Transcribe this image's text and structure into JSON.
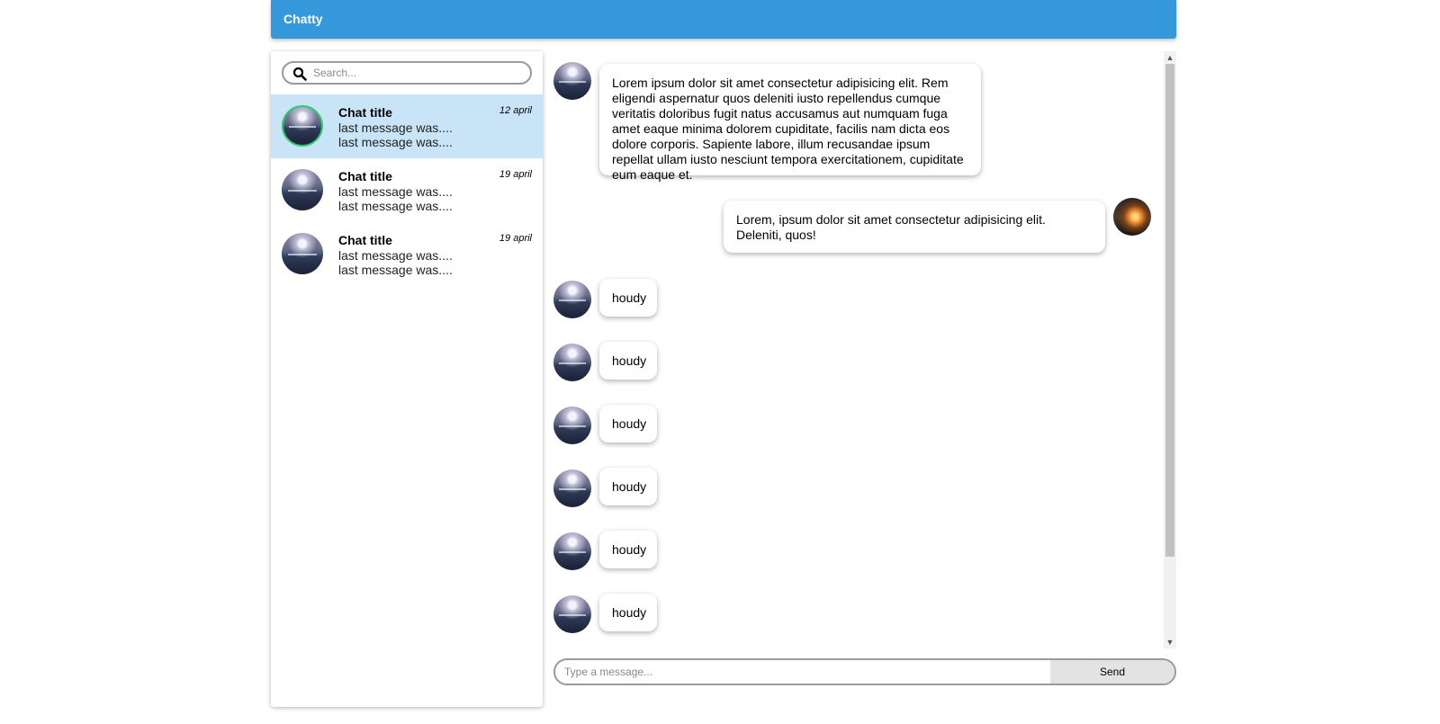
{
  "app": {
    "title": "Chatty",
    "accent_color": "#3498db",
    "active_ring_color": "#2ecc71",
    "active_item_bg": "#c9e4f7"
  },
  "search": {
    "placeholder": "Search...",
    "icon": "search-icon"
  },
  "chats": [
    {
      "title": "Chat title",
      "line1": "last message was....",
      "line2": "last message was....",
      "date": "12 april",
      "active": true
    },
    {
      "title": "Chat title",
      "line1": "last message was....",
      "line2": "last message was....",
      "date": "19 april",
      "active": false
    },
    {
      "title": "Chat title",
      "line1": "last message was....",
      "line2": "last message was....",
      "date": "19 april",
      "active": false
    }
  ],
  "messages": [
    {
      "side": "left",
      "text": "Lorem ipsum dolor sit amet consectetur adipisicing elit. Rem eligendi aspernatur quos deleniti iusto repellendus cumque veritatis doloribus fugit natus accusamus aut numquam fuga amet eaque minima dolorem cupiditate, facilis nam dicta eos dolore corporis. Sapiente labore, illum recusandae ipsum repellat ullam iusto nesciunt tempora exercitationem, cupiditate eum eaque et."
    },
    {
      "side": "right",
      "text": "Lorem, ipsum dolor sit amet consectetur adipisicing elit. Deleniti, quos!"
    },
    {
      "side": "left",
      "text": "houdy"
    },
    {
      "side": "left",
      "text": "houdy"
    },
    {
      "side": "left",
      "text": "houdy"
    },
    {
      "side": "left",
      "text": "houdy"
    },
    {
      "side": "left",
      "text": "houdy"
    },
    {
      "side": "left",
      "text": "houdy"
    }
  ],
  "composer": {
    "placeholder": "Type a message...",
    "send_label": "Send"
  }
}
